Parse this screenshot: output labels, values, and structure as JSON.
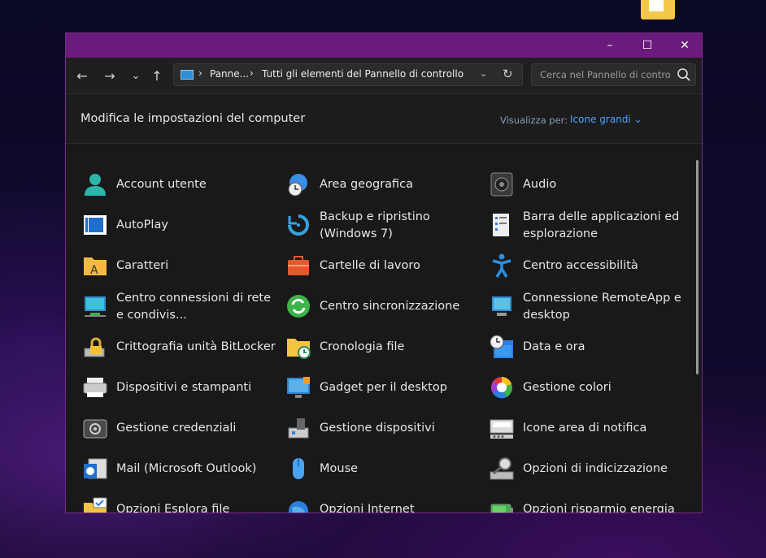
{
  "window": {
    "minimize_label": "–",
    "maximize_label": "☐",
    "close_label": "✕"
  },
  "nav": {
    "back": "←",
    "forward": "→",
    "recent": "⌄",
    "up": "↑",
    "breadcrumb": [
      "Panne...",
      "Tutti gli elementi del Pannello di controllo"
    ],
    "separator": "›",
    "search_placeholder": "Cerca nel Pannello di controllo"
  },
  "header": {
    "title": "Modifica le impostazioni del computer",
    "view_by_label": "Visualizza per:",
    "view_by_value": "Icone grandi ⌄"
  },
  "items": [
    {
      "label": "Account utente",
      "icon": "user-accounts-icon"
    },
    {
      "label": "Area geografica",
      "icon": "region-icon"
    },
    {
      "label": "Audio",
      "icon": "audio-icon"
    },
    {
      "label": "AutoPlay",
      "icon": "autoplay-icon"
    },
    {
      "label": "Backup e ripristino (Windows 7)",
      "icon": "backup-icon"
    },
    {
      "label": "Barra delle applicazioni ed esplorazione",
      "icon": "taskbar-icon"
    },
    {
      "label": "Caratteri",
      "icon": "fonts-icon"
    },
    {
      "label": "Cartelle di lavoro",
      "icon": "work-folders-icon"
    },
    {
      "label": "Centro accessibilità",
      "icon": "accessibility-icon"
    },
    {
      "label": "Centro connessioni di rete e condivis...",
      "icon": "network-icon"
    },
    {
      "label": "Centro sincronizzazione",
      "icon": "sync-center-icon"
    },
    {
      "label": "Connessione RemoteApp e desktop",
      "icon": "remoteapp-icon"
    },
    {
      "label": "Crittografia unità BitLocker",
      "icon": "bitlocker-icon"
    },
    {
      "label": "Cronologia file",
      "icon": "file-history-icon"
    },
    {
      "label": "Data e ora",
      "icon": "date-time-icon"
    },
    {
      "label": "Dispositivi e stampanti",
      "icon": "printer-icon"
    },
    {
      "label": "Gadget per il desktop",
      "icon": "gadgets-icon"
    },
    {
      "label": "Gestione colori",
      "icon": "color-management-icon"
    },
    {
      "label": "Gestione credenziali",
      "icon": "credential-manager-icon"
    },
    {
      "label": "Gestione dispositivi",
      "icon": "device-manager-icon"
    },
    {
      "label": "Icone area di notifica",
      "icon": "notification-icons-icon"
    },
    {
      "label": "Mail (Microsoft Outlook)",
      "icon": "mail-icon"
    },
    {
      "label": "Mouse",
      "icon": "mouse-icon"
    },
    {
      "label": "Opzioni di indicizzazione",
      "icon": "indexing-icon"
    },
    {
      "label": "Opzioni Esplora file",
      "icon": "explorer-options-icon"
    },
    {
      "label": "Opzioni Internet",
      "icon": "internet-options-icon"
    },
    {
      "label": "Opzioni risparmio energia",
      "icon": "power-options-icon"
    }
  ]
}
